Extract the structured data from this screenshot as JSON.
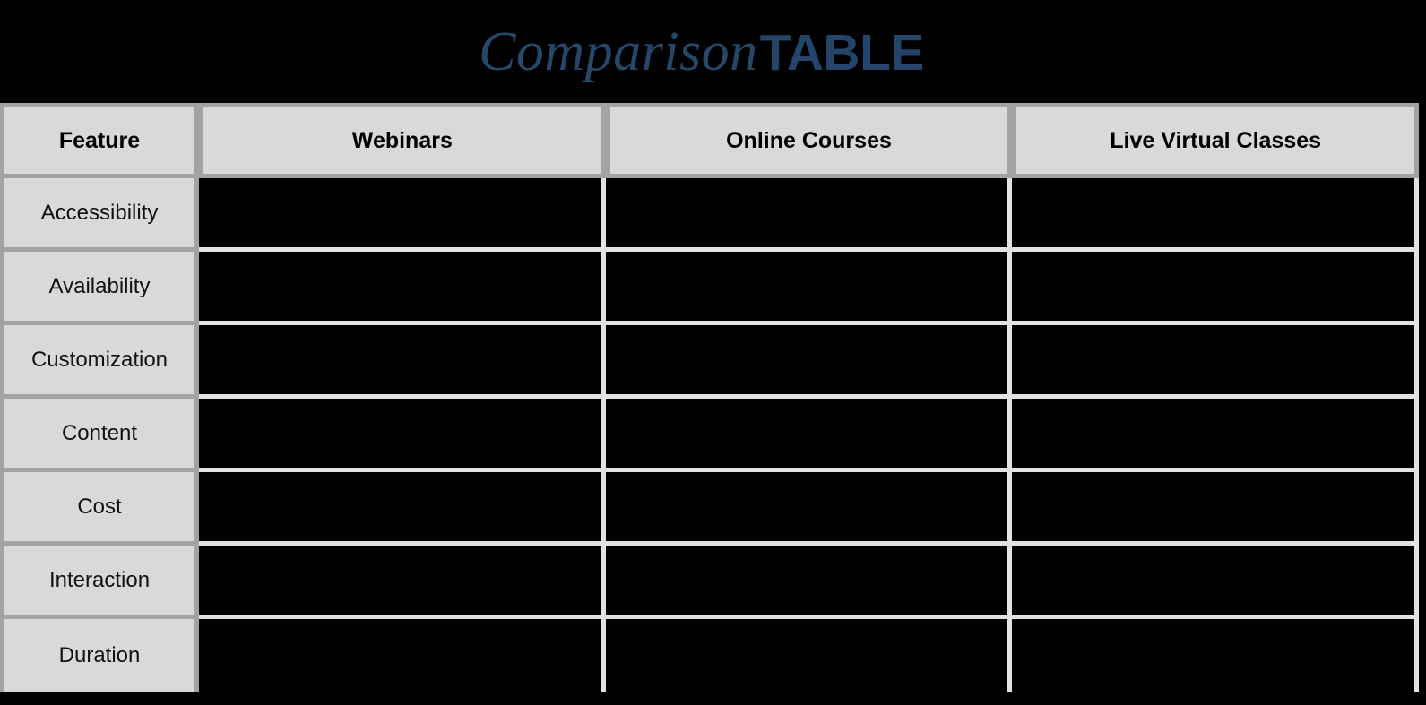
{
  "title": {
    "script_part": "Comparison",
    "bold_part": "TABLE",
    "accent_color": "#254669",
    "background_color": "#000000"
  },
  "table": {
    "header_background": "#d9d9d9",
    "header_border_color": "#a3a3a3",
    "cell_background": "#000000",
    "cell_border_color": "#e2e2e2",
    "columns": [
      {
        "key": "feature",
        "label": "Feature"
      },
      {
        "key": "webinars",
        "label": "Webinars"
      },
      {
        "key": "online_courses",
        "label": "Online Courses"
      },
      {
        "key": "live_virtual_classes",
        "label": "Live Virtual Classes"
      }
    ],
    "rows": [
      {
        "feature": "Accessibility",
        "webinars": "",
        "online_courses": "",
        "live_virtual_classes": ""
      },
      {
        "feature": "Availability",
        "webinars": "",
        "online_courses": "",
        "live_virtual_classes": ""
      },
      {
        "feature": "Customization",
        "webinars": "",
        "online_courses": "",
        "live_virtual_classes": ""
      },
      {
        "feature": "Content",
        "webinars": "",
        "online_courses": "",
        "live_virtual_classes": ""
      },
      {
        "feature": "Cost",
        "webinars": "",
        "online_courses": "",
        "live_virtual_classes": ""
      },
      {
        "feature": "Interaction",
        "webinars": "",
        "online_courses": "",
        "live_virtual_classes": ""
      },
      {
        "feature": "Duration",
        "webinars": "",
        "online_courses": "",
        "live_virtual_classes": ""
      }
    ]
  }
}
